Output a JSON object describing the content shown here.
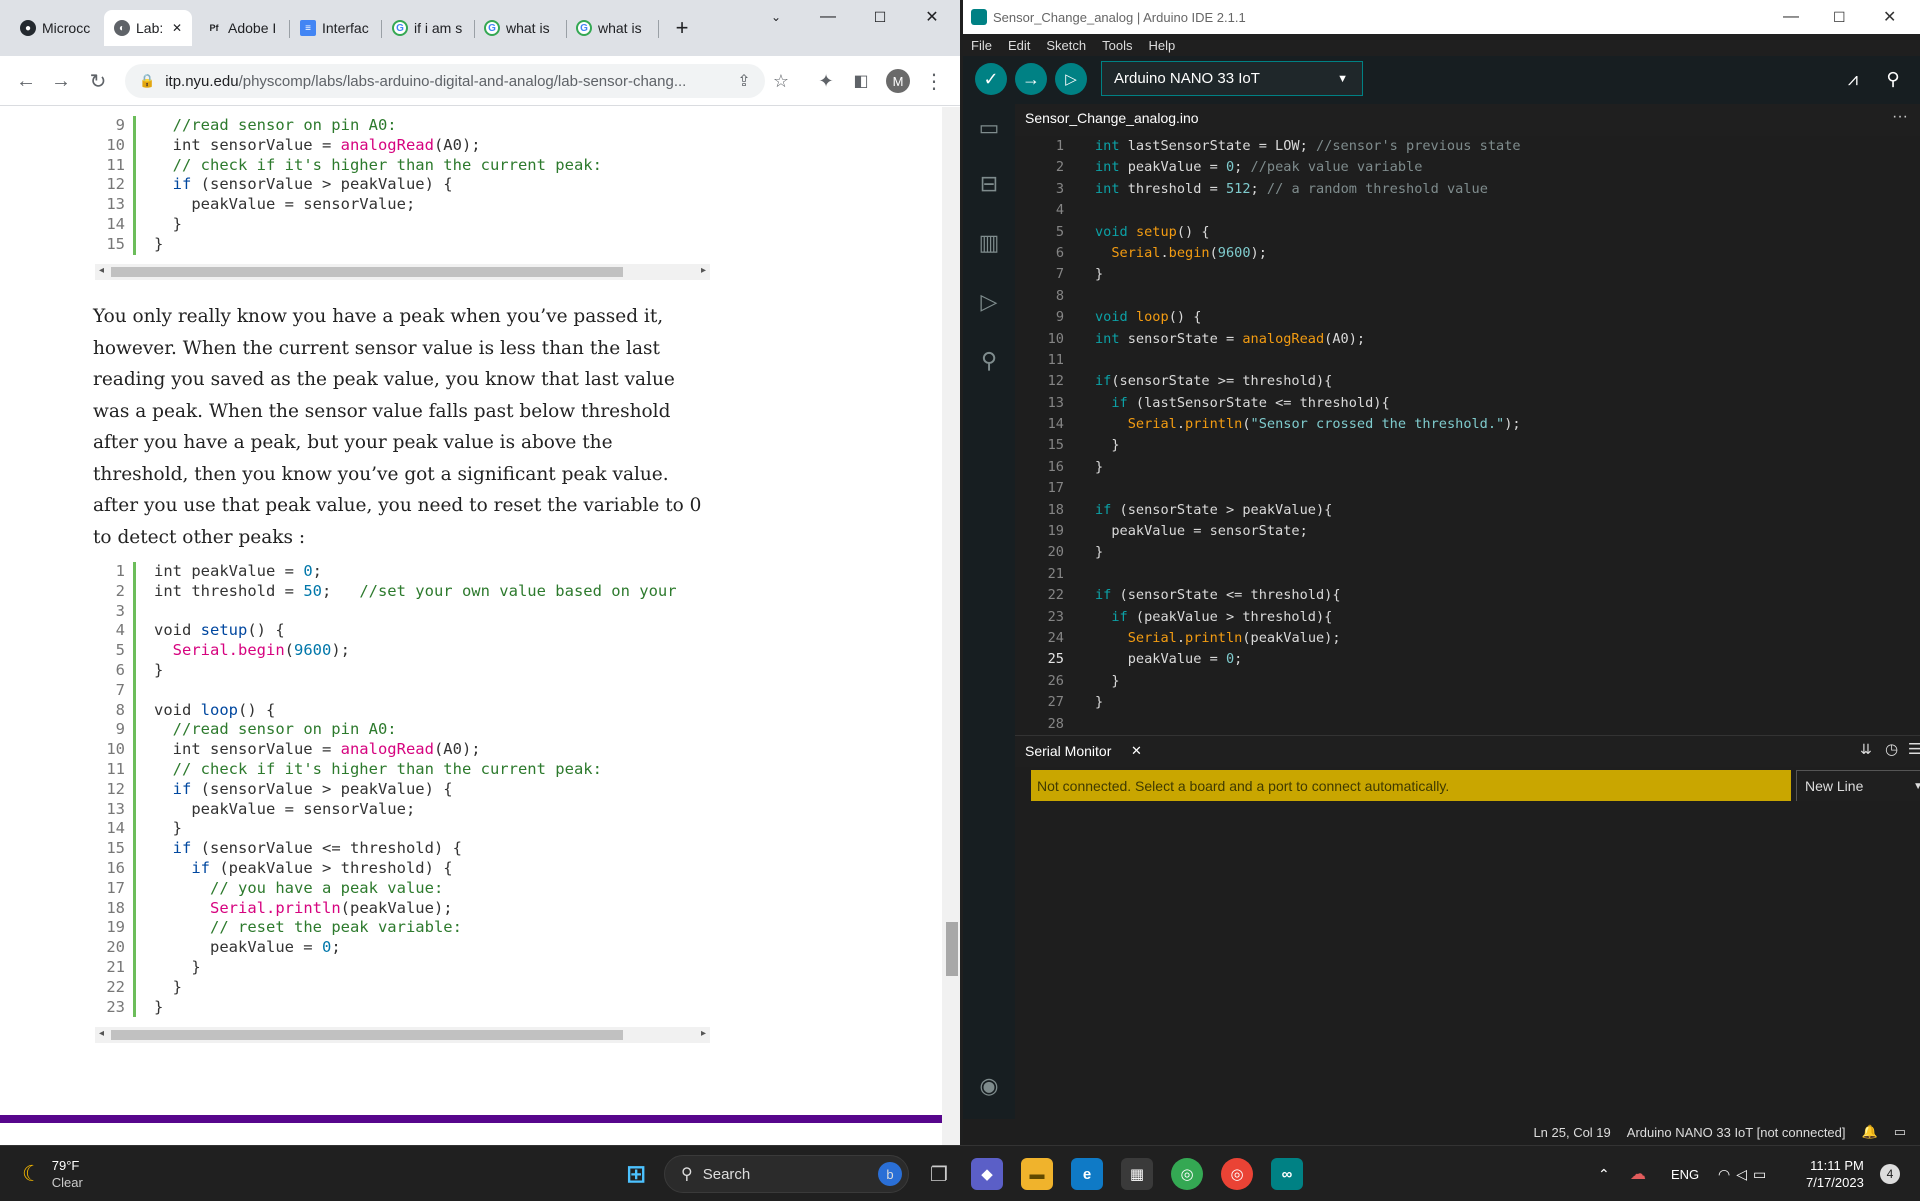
{
  "browser": {
    "tabs": [
      {
        "label": "Microcc",
        "icon": "github-icon"
      },
      {
        "label": "Lab:",
        "icon": "web-icon"
      },
      {
        "label": "Adobe I",
        "icon": "adobe-pdf-icon"
      },
      {
        "label": "Interfac",
        "icon": "docs-icon"
      },
      {
        "label": "if i am s",
        "icon": "google-icon"
      },
      {
        "label": "what is",
        "icon": "google-icon"
      },
      {
        "label": "what is",
        "icon": "google-icon"
      }
    ],
    "close_glyph": "✕",
    "new_tab": "+",
    "url_domain": "itp.nyu.edu",
    "url_path": "/physcomp/labs/labs-arduino-digital-and-analog/lab-sensor-chang...",
    "profile_initial": "M"
  },
  "page": {
    "code1": [
      {
        "n": "9",
        "t": [
          [
            "",
            "  "
          ],
          [
            "cm",
            "//read sensor on pin A0:"
          ]
        ]
      },
      {
        "n": "10",
        "t": [
          [
            "",
            "  int sensorValue = "
          ],
          [
            "fn",
            "analogRead"
          ],
          [
            "",
            "(A0);"
          ]
        ]
      },
      {
        "n": "11",
        "t": [
          [
            "",
            "  "
          ],
          [
            "cm",
            "// check if it's higher than the current peak:"
          ]
        ]
      },
      {
        "n": "12",
        "t": [
          [
            "",
            "  "
          ],
          [
            "k",
            "if"
          ],
          [
            "",
            " (sensorValue > peakValue) {"
          ]
        ]
      },
      {
        "n": "13",
        "t": [
          [
            "",
            "    peakValue = sensorValue;"
          ]
        ]
      },
      {
        "n": "14",
        "t": [
          [
            "",
            "  }"
          ]
        ]
      },
      {
        "n": "15",
        "t": [
          [
            "",
            "}"
          ]
        ]
      }
    ],
    "paragraph": "You only really know you have a peak when you’ve passed it, however. When the current sensor value is less than the last reading you saved as the peak value, you know that last value was a peak. When the sensor value falls past below threshold after you have a peak, but your peak value is above the threshold, then you know you’ve got a significant peak value. after you use that peak value, you need to reset the variable to 0 to detect other peaks :",
    "code2": [
      {
        "n": "1",
        "t": [
          [
            "",
            "int peakValue = "
          ],
          [
            "num",
            "0"
          ],
          [
            "",
            ";"
          ]
        ]
      },
      {
        "n": "2",
        "t": [
          [
            "",
            "int threshold = "
          ],
          [
            "num",
            "50"
          ],
          [
            "",
            ";   "
          ],
          [
            "cm",
            "//set your own value based on your"
          ]
        ]
      },
      {
        "n": "3",
        "t": [
          [
            "",
            ""
          ]
        ]
      },
      {
        "n": "4",
        "t": [
          [
            "",
            "void "
          ],
          [
            "k",
            "setup"
          ],
          [
            "",
            "() {"
          ]
        ]
      },
      {
        "n": "5",
        "t": [
          [
            "",
            "  "
          ],
          [
            "fn",
            "Serial.begin"
          ],
          [
            "",
            "("
          ],
          [
            "num",
            "9600"
          ],
          [
            "",
            ");"
          ]
        ]
      },
      {
        "n": "6",
        "t": [
          [
            "",
            "}"
          ]
        ]
      },
      {
        "n": "7",
        "t": [
          [
            "",
            ""
          ]
        ]
      },
      {
        "n": "8",
        "t": [
          [
            "",
            "void "
          ],
          [
            "k",
            "loop"
          ],
          [
            "",
            "() {"
          ]
        ]
      },
      {
        "n": "9",
        "t": [
          [
            "",
            "  "
          ],
          [
            "cm",
            "//read sensor on pin A0:"
          ]
        ]
      },
      {
        "n": "10",
        "t": [
          [
            "",
            "  int sensorValue = "
          ],
          [
            "fn",
            "analogRead"
          ],
          [
            "",
            "(A0);"
          ]
        ]
      },
      {
        "n": "11",
        "t": [
          [
            "",
            "  "
          ],
          [
            "cm",
            "// check if it's higher than the current peak:"
          ]
        ]
      },
      {
        "n": "12",
        "t": [
          [
            "",
            "  "
          ],
          [
            "k",
            "if"
          ],
          [
            "",
            " (sensorValue > peakValue) {"
          ]
        ]
      },
      {
        "n": "13",
        "t": [
          [
            "",
            "    peakValue = sensorValue;"
          ]
        ]
      },
      {
        "n": "14",
        "t": [
          [
            "",
            "  }"
          ]
        ]
      },
      {
        "n": "15",
        "t": [
          [
            "",
            "  "
          ],
          [
            "k",
            "if"
          ],
          [
            "",
            " (sensorValue <= threshold) {"
          ]
        ]
      },
      {
        "n": "16",
        "t": [
          [
            "",
            "    "
          ],
          [
            "k",
            "if"
          ],
          [
            "",
            " (peakValue > threshold) {"
          ]
        ]
      },
      {
        "n": "17",
        "t": [
          [
            "",
            "      "
          ],
          [
            "cm",
            "// you have a peak value:"
          ]
        ]
      },
      {
        "n": "18",
        "t": [
          [
            "",
            "      "
          ],
          [
            "fn",
            "Serial.println"
          ],
          [
            "",
            "(peakValue);"
          ]
        ]
      },
      {
        "n": "19",
        "t": [
          [
            "",
            "      "
          ],
          [
            "cm",
            "// reset the peak variable:"
          ]
        ]
      },
      {
        "n": "20",
        "t": [
          [
            "",
            "      peakValue = "
          ],
          [
            "num",
            "0"
          ],
          [
            "",
            ";"
          ]
        ]
      },
      {
        "n": "21",
        "t": [
          [
            "",
            "    }"
          ]
        ]
      },
      {
        "n": "22",
        "t": [
          [
            "",
            "  }"
          ]
        ]
      },
      {
        "n": "23",
        "t": [
          [
            "",
            "}"
          ]
        ]
      }
    ]
  },
  "ide": {
    "title": "Sensor_Change_analog | Arduino IDE 2.1.1",
    "menu": [
      "File",
      "Edit",
      "Sketch",
      "Tools",
      "Help"
    ],
    "board": "Arduino NANO 33 IoT",
    "file_tab": "Sensor_Change_analog.ino",
    "more": "···",
    "current_line": "25",
    "code": [
      {
        "n": "1",
        "t": [
          [
            "ak",
            "int"
          ],
          [
            "",
            " lastSensorState = LOW; "
          ],
          [
            "ac",
            "//sensor's previous state"
          ]
        ]
      },
      {
        "n": "2",
        "t": [
          [
            "ak",
            "int"
          ],
          [
            "",
            " peakValue = "
          ],
          [
            "an",
            "0"
          ],
          [
            "",
            "; "
          ],
          [
            "ac",
            "//peak value variable"
          ]
        ]
      },
      {
        "n": "3",
        "t": [
          [
            "ak",
            "int"
          ],
          [
            "",
            " threshold = "
          ],
          [
            "an",
            "512"
          ],
          [
            "",
            "; "
          ],
          [
            "ac",
            "// a random threshold value"
          ]
        ]
      },
      {
        "n": "4",
        "t": [
          [
            "",
            ""
          ]
        ]
      },
      {
        "n": "5",
        "t": [
          [
            "ak",
            "void"
          ],
          [
            "",
            " "
          ],
          [
            "af",
            "setup"
          ],
          [
            "",
            "() {"
          ]
        ]
      },
      {
        "n": "6",
        "t": [
          [
            "",
            "  "
          ],
          [
            "af",
            "Serial"
          ],
          [
            "",
            "."
          ],
          [
            "af",
            "begin"
          ],
          [
            "",
            "("
          ],
          [
            "an",
            "9600"
          ],
          [
            "",
            ");"
          ]
        ]
      },
      {
        "n": "7",
        "t": [
          [
            "",
            "}"
          ]
        ]
      },
      {
        "n": "8",
        "t": [
          [
            "",
            ""
          ]
        ]
      },
      {
        "n": "9",
        "t": [
          [
            "ak",
            "void"
          ],
          [
            "",
            " "
          ],
          [
            "af",
            "loop"
          ],
          [
            "",
            "() {"
          ]
        ]
      },
      {
        "n": "10",
        "t": [
          [
            "ak",
            "int"
          ],
          [
            "",
            " sensorState = "
          ],
          [
            "af",
            "analogRead"
          ],
          [
            "",
            "(A0);"
          ]
        ]
      },
      {
        "n": "11",
        "t": [
          [
            "",
            ""
          ]
        ]
      },
      {
        "n": "12",
        "t": [
          [
            "ak",
            "if"
          ],
          [
            "",
            "(sensorState >= threshold){"
          ]
        ]
      },
      {
        "n": "13",
        "t": [
          [
            "",
            "  "
          ],
          [
            "ak",
            "if"
          ],
          [
            "",
            " (lastSensorState <= threshold){"
          ]
        ]
      },
      {
        "n": "14",
        "t": [
          [
            "",
            "    "
          ],
          [
            "af",
            "Serial"
          ],
          [
            "",
            "."
          ],
          [
            "af",
            "println"
          ],
          [
            "",
            "("
          ],
          [
            "as",
            "\"Sensor crossed the threshold.\""
          ],
          [
            "",
            ");"
          ]
        ]
      },
      {
        "n": "15",
        "t": [
          [
            "",
            "  }"
          ]
        ]
      },
      {
        "n": "16",
        "t": [
          [
            "",
            "}"
          ]
        ]
      },
      {
        "n": "17",
        "t": [
          [
            "",
            ""
          ]
        ]
      },
      {
        "n": "18",
        "t": [
          [
            "ak",
            "if"
          ],
          [
            "",
            " (sensorState > peakValue){"
          ]
        ]
      },
      {
        "n": "19",
        "t": [
          [
            "",
            "  peakValue = sensorState;"
          ]
        ]
      },
      {
        "n": "20",
        "t": [
          [
            "",
            "}"
          ]
        ]
      },
      {
        "n": "21",
        "t": [
          [
            "",
            ""
          ]
        ]
      },
      {
        "n": "22",
        "t": [
          [
            "ak",
            "if"
          ],
          [
            "",
            " (sensorState <= threshold){"
          ]
        ]
      },
      {
        "n": "23",
        "t": [
          [
            "",
            "  "
          ],
          [
            "ak",
            "if"
          ],
          [
            "",
            " (peakValue > threshold){"
          ]
        ]
      },
      {
        "n": "24",
        "t": [
          [
            "",
            "    "
          ],
          [
            "af",
            "Serial"
          ],
          [
            "",
            "."
          ],
          [
            "af",
            "println"
          ],
          [
            "",
            "(peakValue);"
          ]
        ]
      },
      {
        "n": "25",
        "t": [
          [
            "",
            "    peakValue = "
          ],
          [
            "an",
            "0"
          ],
          [
            "",
            ";"
          ]
        ]
      },
      {
        "n": "26",
        "t": [
          [
            "",
            "  }"
          ]
        ]
      },
      {
        "n": "27",
        "t": [
          [
            "",
            "}"
          ]
        ]
      },
      {
        "n": "28",
        "t": [
          [
            "",
            ""
          ]
        ]
      }
    ],
    "serial": {
      "title": "Serial Monitor",
      "close": "✕",
      "message": "Not connected. Select a board and a port to connect automatically.",
      "line_ending": "New Line"
    },
    "status": {
      "position": "Ln 25, Col 19",
      "board": "Arduino NANO 33 IoT [not connected]"
    }
  },
  "taskbar": {
    "weather_temp": "79°F",
    "weather_cond": "Clear",
    "search": "Search",
    "lang": "ENG",
    "time": "11:11 PM",
    "date": "7/17/2023",
    "notifications": "4"
  },
  "colors": {
    "arduino_teal": "#008184",
    "serial_warning": "#c9a600",
    "nyu_purple": "#57068c"
  }
}
